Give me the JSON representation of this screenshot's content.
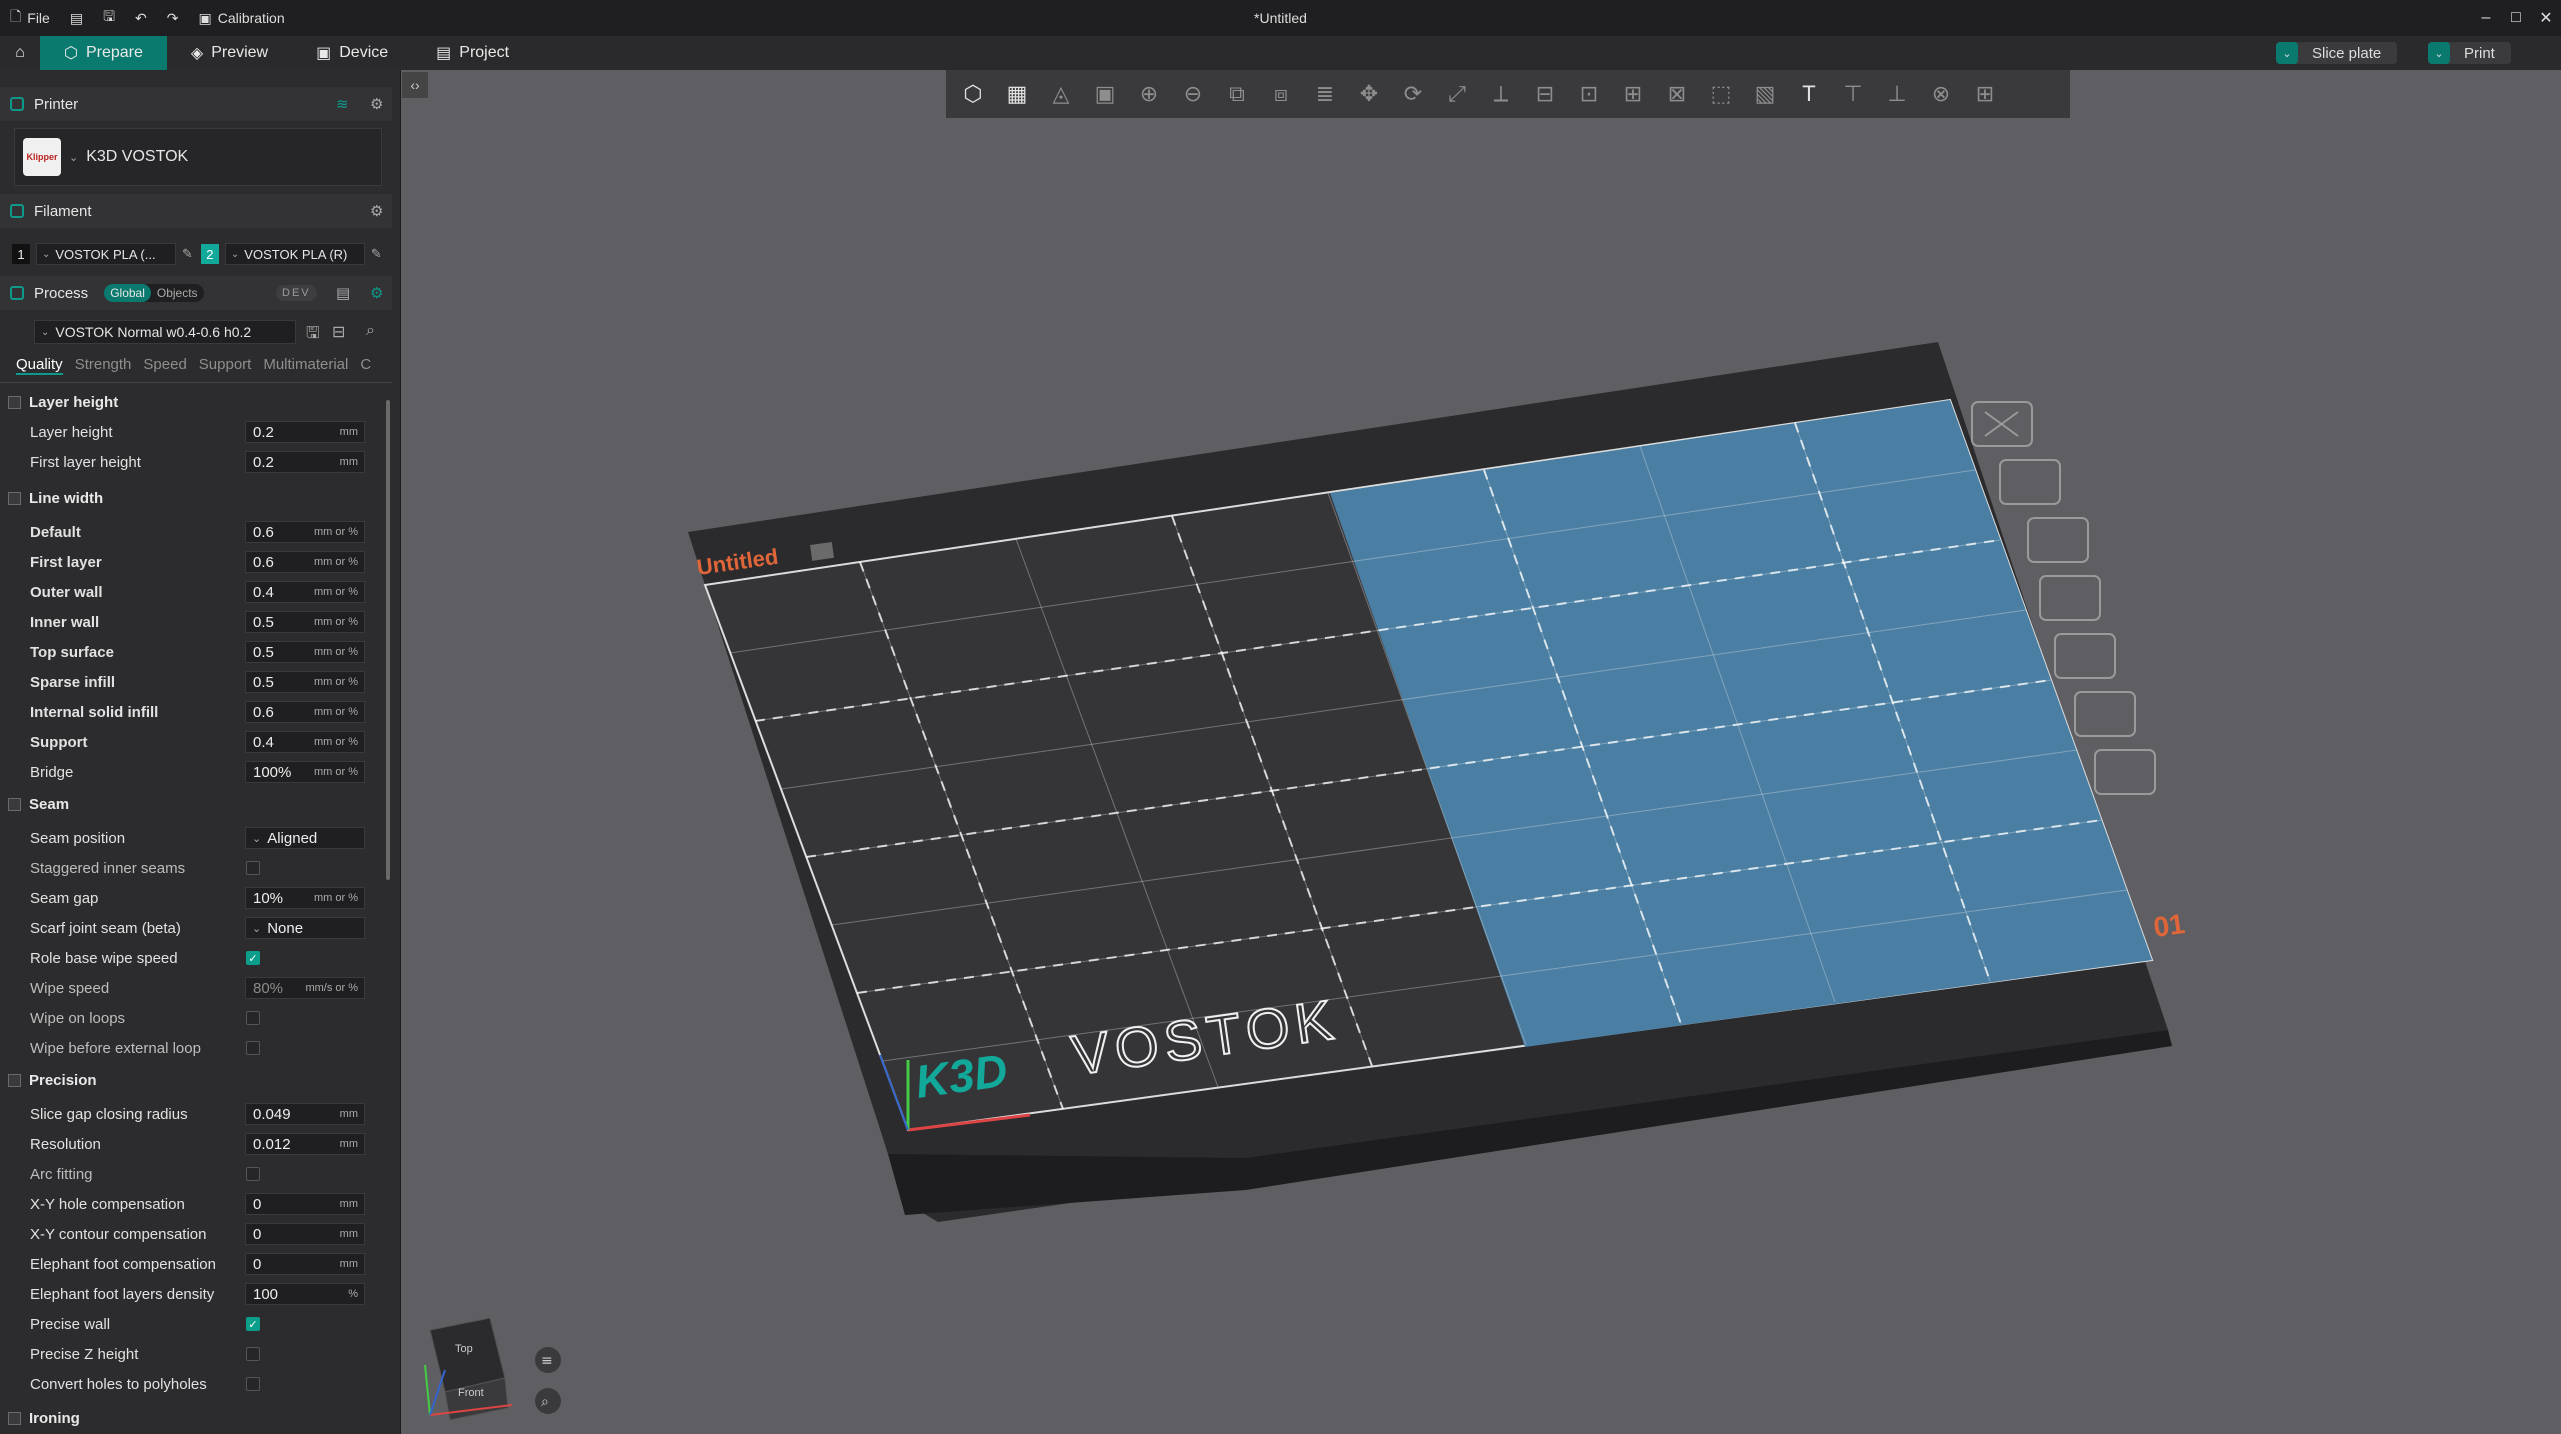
{
  "titlebar": {
    "file_label": "File",
    "calibration_label": "Calibration",
    "document_title": "*Untitled",
    "minimize": "–",
    "maximize": "□",
    "close": "✕"
  },
  "tabs": {
    "prepare": "Prepare",
    "preview": "Preview",
    "device": "Device",
    "project": "Project"
  },
  "actions": {
    "slice_plate": "Slice plate",
    "print": "Print"
  },
  "printer": {
    "header": "Printer",
    "name": "K3D VOSTOK",
    "logo_text": "Klipper"
  },
  "filament": {
    "header": "Filament",
    "slot1_num": "1",
    "slot1_name": "VOSTOK PLA (...",
    "slot2_num": "2",
    "slot2_name": "VOSTOK PLA (R)"
  },
  "process": {
    "header": "Process",
    "toggle_global": "Global",
    "toggle_objects": "Objects",
    "mode": "DEV",
    "preset": "VOSTOK Normal w0.4-0.6 h0.2",
    "tabs": [
      "Quality",
      "Strength",
      "Speed",
      "Support",
      "Multimaterial",
      "C"
    ]
  },
  "quality": {
    "layer_height_group": "Layer height",
    "layer_height_label": "Layer height",
    "layer_height_value": "0.2",
    "first_layer_height_label": "First layer height",
    "first_layer_height_value": "0.2",
    "line_width_group": "Line width",
    "unit_mm": "mm",
    "unit_mm_or_pct": "mm or %",
    "unit_mm_s_or_pct": "mm/s or %",
    "unit_pct": "%",
    "line_widths": [
      {
        "label": "Default",
        "value": "0.6"
      },
      {
        "label": "First layer",
        "value": "0.6"
      },
      {
        "label": "Outer wall",
        "value": "0.4"
      },
      {
        "label": "Inner wall",
        "value": "0.5"
      },
      {
        "label": "Top surface",
        "value": "0.5"
      },
      {
        "label": "Sparse infill",
        "value": "0.5"
      },
      {
        "label": "Internal solid infill",
        "value": "0.6"
      },
      {
        "label": "Support",
        "value": "0.4"
      },
      {
        "label": "Bridge",
        "value": "100%"
      }
    ],
    "seam_group": "Seam",
    "seam_position_label": "Seam position",
    "seam_position_value": "Aligned",
    "staggered_label": "Staggered inner seams",
    "seam_gap_label": "Seam gap",
    "seam_gap_value": "10%",
    "scarf_label": "Scarf joint seam (beta)",
    "scarf_value": "None",
    "role_wipe_label": "Role base wipe speed",
    "wipe_speed_label": "Wipe speed",
    "wipe_speed_value": "80%",
    "wipe_loops_label": "Wipe on loops",
    "wipe_before_label": "Wipe before external loop",
    "precision_group": "Precision",
    "slice_gap_label": "Slice gap closing radius",
    "slice_gap_value": "0.049",
    "resolution_label": "Resolution",
    "resolution_value": "0.012",
    "arc_label": "Arc fitting",
    "xy_hole_label": "X-Y hole compensation",
    "xy_hole_value": "0",
    "xy_contour_label": "X-Y contour compensation",
    "xy_contour_value": "0",
    "elephant_label": "Elephant foot compensation",
    "elephant_value": "0",
    "elephant_density_label": "Elephant foot layers density",
    "elephant_density_value": "100",
    "precise_wall_label": "Precise wall",
    "precise_z_label": "Precise Z height",
    "convert_holes_label": "Convert holes to polyholes",
    "ironing_group": "Ironing"
  },
  "plate": {
    "name": "Untitled",
    "index": "01",
    "brand_a": "K3D",
    "brand_b": "VOSTOK"
  },
  "navcube": {
    "top": "Top",
    "front": "Front"
  },
  "colors": {
    "accent": "#0b7a6e",
    "plate_label": "#e0663a"
  }
}
